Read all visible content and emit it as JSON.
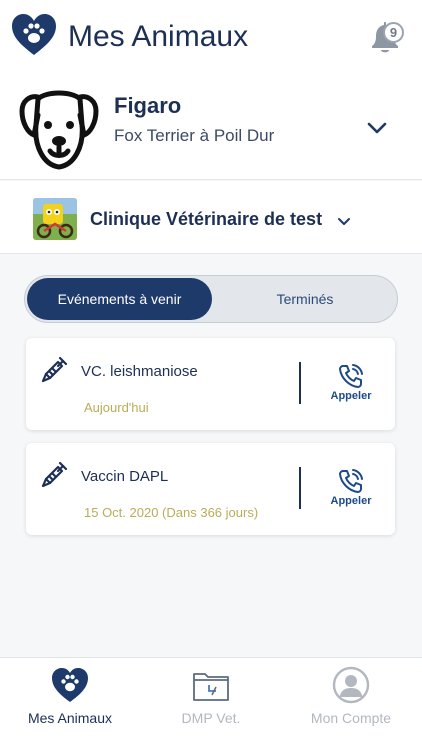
{
  "header": {
    "title": "Mes Animaux",
    "notification_count": "9"
  },
  "pet": {
    "name": "Figaro",
    "breed": "Fox Terrier à Poil Dur"
  },
  "clinic": {
    "name": "Clinique Vétérinaire de test"
  },
  "segmented": {
    "active_label": "Evénements à venir",
    "inactive_label": "Terminés"
  },
  "events": [
    {
      "title": "VC. leishmaniose",
      "date": "Aujourd'hui",
      "action": "Appeler"
    },
    {
      "title": "Vaccin DAPL",
      "date": "15 Oct. 2020 (Dans 366 jours)",
      "action": "Appeler"
    }
  ],
  "tabbar": {
    "items": [
      {
        "label": "Mes Animaux",
        "icon": "heart-paw-icon"
      },
      {
        "label": "DMP Vet.",
        "icon": "folder-icon"
      },
      {
        "label": "Mon Compte",
        "icon": "account-icon"
      }
    ]
  },
  "colors": {
    "primary": "#1d2f55",
    "accent_date": "#b9ad5a",
    "active_segment": "#1d3a6b",
    "inactive_tab": "#b3b8c0"
  }
}
